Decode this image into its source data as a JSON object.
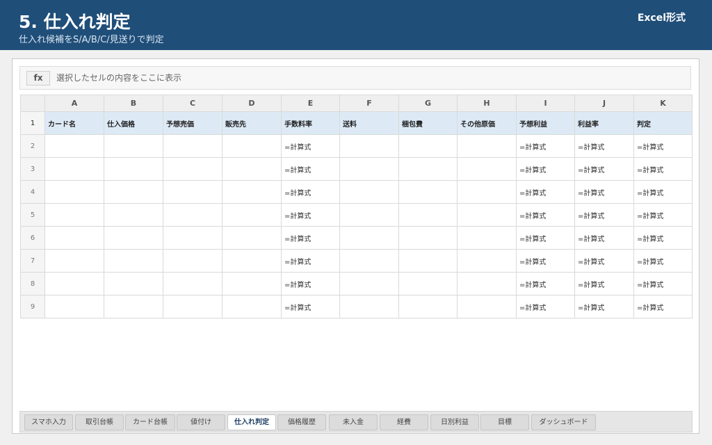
{
  "header": {
    "title": "5. 仕入れ判定",
    "subtitle": "仕入れ候補をS/A/B/C/見送りで判定",
    "format_label": "Excel形式"
  },
  "formula_bar": {
    "fx_label": "fx",
    "placeholder": "選択したセルの内容をここに表示"
  },
  "sheet": {
    "column_letters": [
      "A",
      "B",
      "C",
      "D",
      "E",
      "F",
      "G",
      "H",
      "I",
      "J",
      "K"
    ],
    "header_row_number": "1",
    "headers": [
      "カード名",
      "仕入価格",
      "予想売価",
      "販売先",
      "手数料率",
      "送料",
      "梱包費",
      "その他原価",
      "予想利益",
      "利益率",
      "判定"
    ],
    "rows": [
      {
        "num": "2",
        "cells": [
          "",
          "",
          "",
          "",
          "=計算式",
          "",
          "",
          "",
          "=計算式",
          "=計算式",
          "=計算式"
        ]
      },
      {
        "num": "3",
        "cells": [
          "",
          "",
          "",
          "",
          "=計算式",
          "",
          "",
          "",
          "=計算式",
          "=計算式",
          "=計算式"
        ]
      },
      {
        "num": "4",
        "cells": [
          "",
          "",
          "",
          "",
          "=計算式",
          "",
          "",
          "",
          "=計算式",
          "=計算式",
          "=計算式"
        ]
      },
      {
        "num": "5",
        "cells": [
          "",
          "",
          "",
          "",
          "=計算式",
          "",
          "",
          "",
          "=計算式",
          "=計算式",
          "=計算式"
        ]
      },
      {
        "num": "6",
        "cells": [
          "",
          "",
          "",
          "",
          "=計算式",
          "",
          "",
          "",
          "=計算式",
          "=計算式",
          "=計算式"
        ]
      },
      {
        "num": "7",
        "cells": [
          "",
          "",
          "",
          "",
          "=計算式",
          "",
          "",
          "",
          "=計算式",
          "=計算式",
          "=計算式"
        ]
      },
      {
        "num": "8",
        "cells": [
          "",
          "",
          "",
          "",
          "=計算式",
          "",
          "",
          "",
          "=計算式",
          "=計算式",
          "=計算式"
        ]
      },
      {
        "num": "9",
        "cells": [
          "",
          "",
          "",
          "",
          "=計算式",
          "",
          "",
          "",
          "=計算式",
          "=計算式",
          "=計算式"
        ]
      }
    ]
  },
  "tabs": [
    {
      "label": "スマホ入力",
      "active": false
    },
    {
      "label": "取引台帳",
      "active": false
    },
    {
      "label": "カード台帳",
      "active": false
    },
    {
      "label": "値付け",
      "active": false
    },
    {
      "label": "仕入れ判定",
      "active": true
    },
    {
      "label": "価格履歴",
      "active": false
    },
    {
      "label": "未入金",
      "active": false
    },
    {
      "label": "経費",
      "active": false
    },
    {
      "label": "日別利益",
      "active": false
    },
    {
      "label": "目標",
      "active": false
    },
    {
      "label": "ダッシュボード",
      "active": false
    }
  ],
  "colors": {
    "header_bg": "#1f4e79",
    "header_row_bg": "#ddeaf6",
    "active_tab_text": "#1f3f66"
  }
}
